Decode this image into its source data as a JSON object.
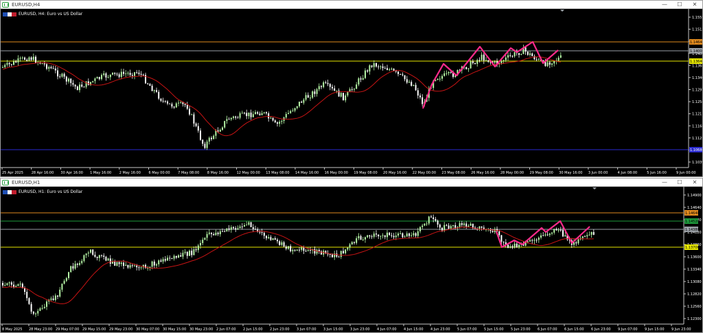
{
  "windows": [
    {
      "title": "EURUSD,H4",
      "chart_label": "EURUSD, H4:  Euro vs US Dollar",
      "price_labels": [
        "1.15550",
        "1.15120",
        "1.14690",
        "1.14000",
        "1.13640",
        "1.13400",
        "1.12970",
        "1.12540",
        "1.12110",
        "1.11680",
        "1.11250",
        "1.10820",
        "1.10390"
      ],
      "time_labels": [
        "25 Apr 2025",
        "28 Apr 16:00",
        "30 Apr 16:00",
        "1 May 16:00",
        "2 May 16:00",
        "6 May 00:00",
        "7 May 08:00",
        "8 May 16:00",
        "12 May 00:00",
        "13 May 08:00",
        "14 May 16:00",
        "16 May 00:00",
        "19 May 08:00",
        "20 May 16:00",
        "22 May 00:00",
        "23 May 08:00",
        "26 May 16:00",
        "28 May 00:00",
        "29 May 08:00",
        "30 May 16:00",
        "3 Jun 00:00",
        "4 Jun 08:00",
        "5 Jun 16:00",
        "9 Jun 00:00"
      ],
      "tags": {
        "orange": "1.14640",
        "gray": "1.14000",
        "yellow": "1.13640",
        "blue": "1.10680"
      }
    },
    {
      "title": "EURUSD,H1",
      "chart_label": "EURUSD, H1:  Euro vs US Dollar",
      "price_labels": [
        "1.14900",
        "1.14640",
        "1.14380",
        "1.14120",
        "1.13860",
        "1.13600",
        "1.13340",
        "1.13080",
        "1.12820",
        "1.12560",
        "1.12300"
      ],
      "time_labels": [
        "8 May 2025",
        "28 May 23:00",
        "29 May 07:00",
        "29 May 15:00",
        "29 May 23:00",
        "30 May 07:00",
        "30 May 15:00",
        "30 May 23:00",
        "2 Jun 07:00",
        "2 Jun 15:00",
        "2 Jun 23:00",
        "3 Jun 07:00",
        "3 Jun 15:00",
        "3 Jun 23:00",
        "4 Jun 07:00",
        "4 Jun 15:00",
        "4 Jun 23:00",
        "5 Jun 07:00",
        "5 Jun 15:00",
        "5 Jun 23:00",
        "6 Jun 07:00",
        "6 Jun 15:00",
        "6 Jun 23:00",
        "9 Jun 07:00",
        "9 Jun 15:00",
        "9 Jun 23:00"
      ],
      "tags": {
        "orange": "1.14640",
        "green": "1.14520",
        "gray": "1.14380",
        "yellow": "1.13706"
      }
    }
  ],
  "window_controls": {
    "minimize": "—",
    "maximize": "☐",
    "close": "✕"
  },
  "colors": {
    "background": "#000000",
    "bull_candle": "#b6f5a6",
    "bear_candle": "#ffffff",
    "moving_average": "#c81414",
    "zigzag": "#ff2a8a",
    "orange_line": "#e08a1e",
    "yellow_line": "#e6e600",
    "gray_line": "#9aa0a6",
    "blue_line": "#2a2ad0"
  }
}
